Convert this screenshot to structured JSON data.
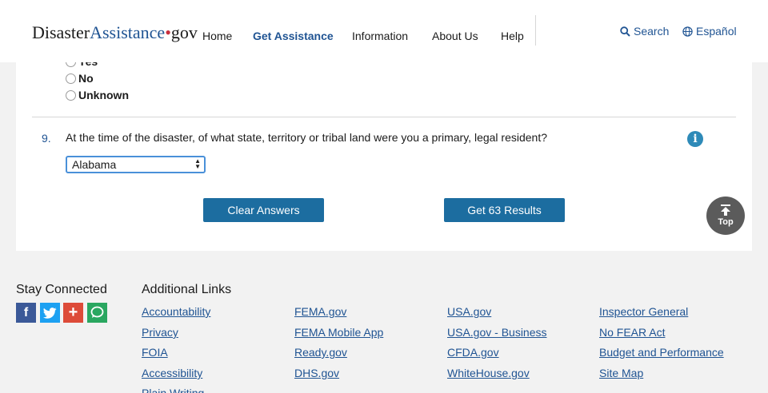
{
  "header": {
    "logo": {
      "part1": "Disaster",
      "part2": "Assistance",
      "dot": "•",
      "part3": "gov"
    },
    "nav": [
      "Home",
      "Get Assistance",
      "Information",
      "About Us",
      "Help"
    ],
    "search_label": "Search",
    "language_label": "Español"
  },
  "question_prev": {
    "options": [
      "Yes",
      "No",
      "Unknown"
    ]
  },
  "question9": {
    "number": "9.",
    "text": "At the time of the disaster, of what state, territory or tribal land were you a primary, legal resident?",
    "info_icon": "i",
    "select_value": "Alabama"
  },
  "actions": {
    "clear_label": "Clear Answers",
    "results_label": "Get 63 Results"
  },
  "back_to_top": {
    "label": "Top"
  },
  "footer": {
    "stay_connected": "Stay Connected",
    "additional_links": "Additional Links",
    "social": [
      "f",
      "t",
      "+",
      "○"
    ],
    "links": [
      [
        "Accountability",
        "Privacy",
        "FOIA",
        "Accessibility",
        "Plain Writing"
      ],
      [
        "FEMA.gov",
        "FEMA Mobile App",
        "Ready.gov",
        "DHS.gov"
      ],
      [
        "USA.gov",
        "USA.gov - Business",
        "CFDA.gov",
        "WhiteHouse.gov"
      ],
      [
        "Inspector General",
        "No FEAR Act",
        "Budget and Performance",
        "Site Map"
      ]
    ]
  },
  "colors": {
    "brand_blue": "#205493",
    "button_blue": "#1c6da0",
    "info_blue": "#2e8ab8",
    "logo_dot": "#c9303e"
  }
}
